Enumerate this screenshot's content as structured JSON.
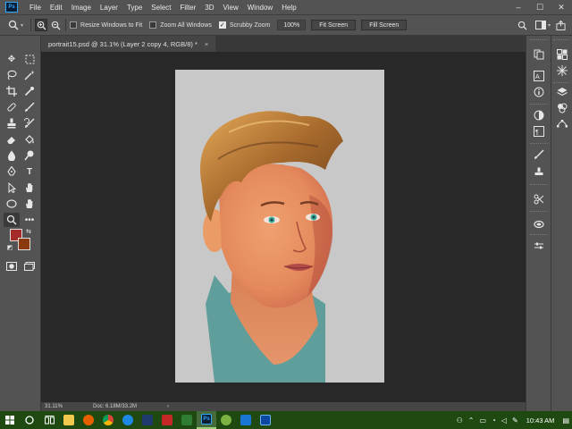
{
  "app": {
    "logo": "Ps",
    "menu": [
      "File",
      "Edit",
      "Image",
      "Layer",
      "Type",
      "Select",
      "Filter",
      "3D",
      "View",
      "Window",
      "Help"
    ],
    "window_controls": [
      "–",
      "☐",
      "✕"
    ]
  },
  "options_bar": {
    "tool_icon": "zoom-icon",
    "resize_windows": {
      "label": "Resize Windows to Fit",
      "checked": false
    },
    "zoom_all": {
      "label": "Zoom All Windows",
      "checked": false
    },
    "scrubby_zoom": {
      "label": "Scrubby Zoom",
      "checked": true
    },
    "zoom_value": "100%",
    "fit_screen": "Fit Screen",
    "fill_screen": "Fill Screen"
  },
  "document": {
    "tab_title": "portrait15.psd @ 31.1% (Layer 2 copy 4, RGB/8) *",
    "close": "×"
  },
  "status": {
    "zoom": "31.11%",
    "doc_size": "Doc: 6.18M/33.2M",
    "arrow": "›"
  },
  "colors": {
    "foreground": "#a52a2a",
    "background": "#8b3a10",
    "canvas_bg": "#c8c8c8",
    "shirt": "#5f9e9a"
  },
  "taskbar": {
    "time": "10:43 AM",
    "apps": [
      "windows-start",
      "cortana",
      "task-view",
      "file-explorer",
      "firefox",
      "chrome",
      "edge",
      "app-blue",
      "app-red",
      "app-green",
      "photoshop",
      "app-chat",
      "vscode",
      "app-mail"
    ]
  }
}
